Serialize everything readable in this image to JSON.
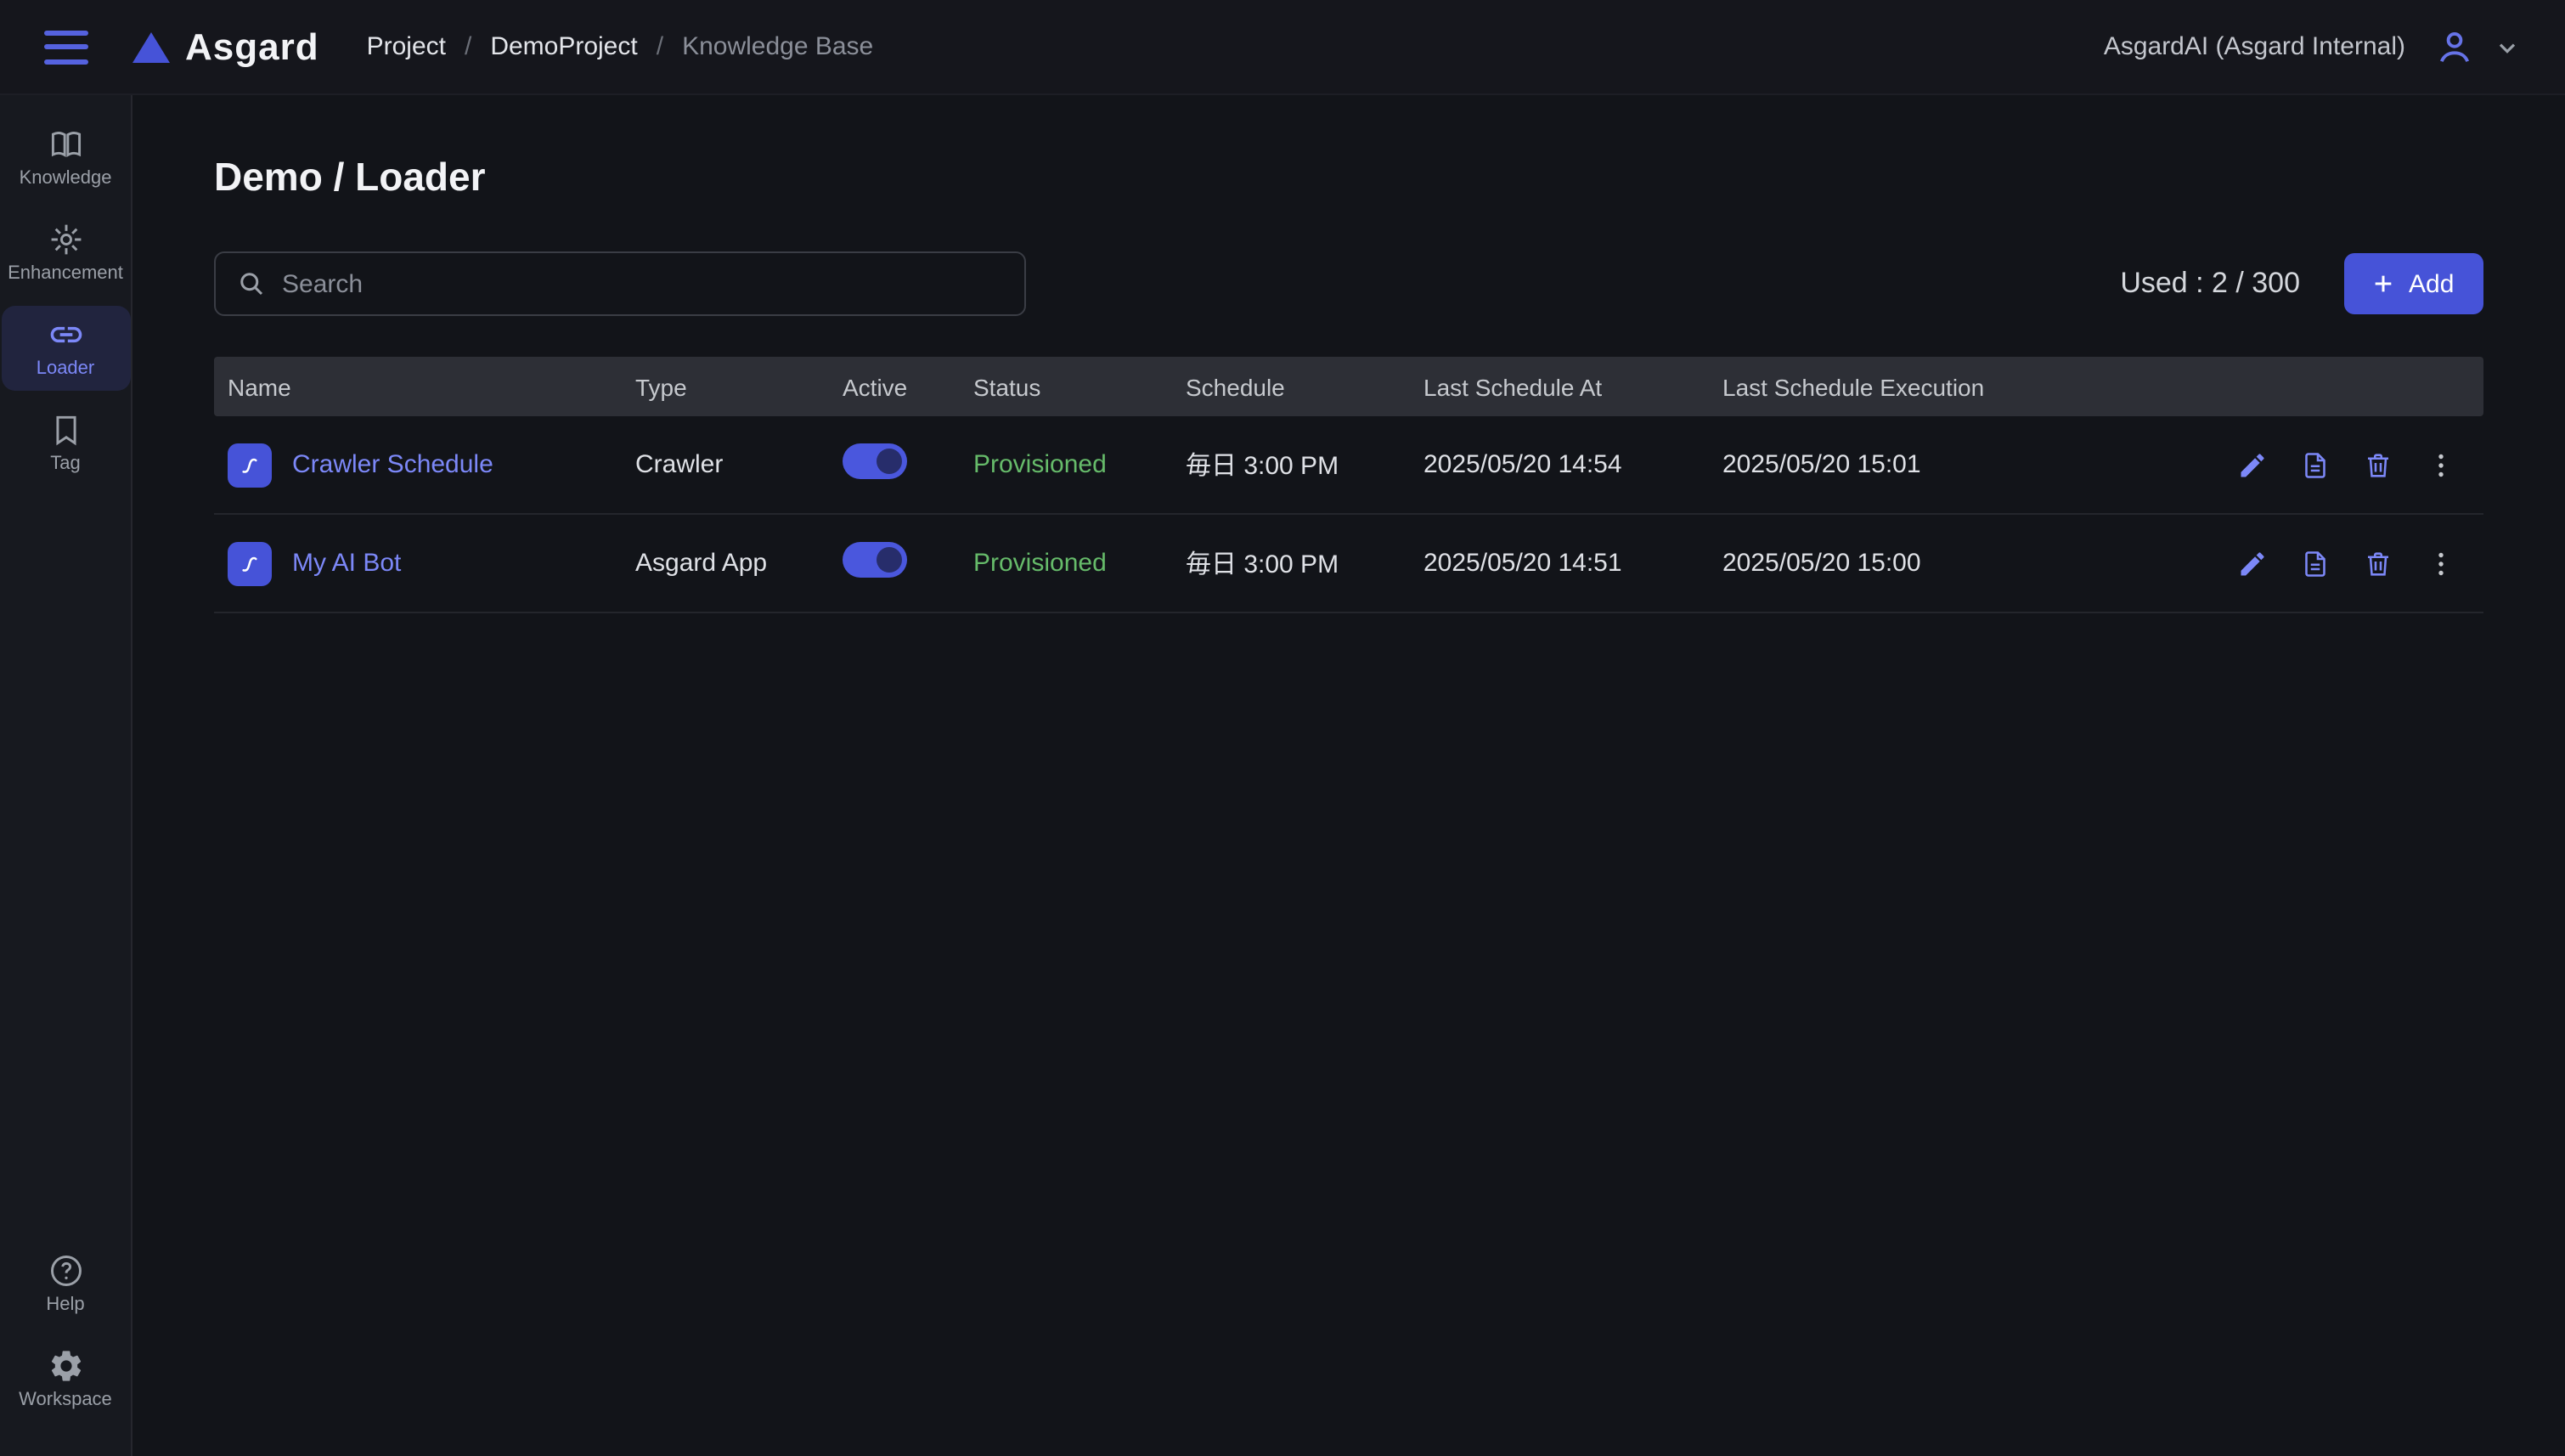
{
  "topbar": {
    "logo_text": "Asgard",
    "breadcrumb": {
      "items": [
        "Project",
        "DemoProject",
        "Knowledge Base"
      ],
      "separator": "/"
    },
    "account_label": "AsgardAI (Asgard Internal)"
  },
  "sidebar": {
    "items": [
      {
        "label": "Knowledge",
        "icon": "book-icon",
        "active": false
      },
      {
        "label": "Enhancement",
        "icon": "flare-icon",
        "active": false
      },
      {
        "label": "Loader",
        "icon": "link-icon",
        "active": true
      },
      {
        "label": "Tag",
        "icon": "bookmark-icon",
        "active": false
      }
    ],
    "bottom_items": [
      {
        "label": "Help",
        "icon": "help-icon"
      },
      {
        "label": "Workspace",
        "icon": "gear-icon"
      }
    ]
  },
  "main": {
    "title": "Demo / Loader",
    "search": {
      "placeholder": "Search"
    },
    "usage_label": "Used : 2 / 300",
    "add_button_label": "Add",
    "table": {
      "columns": [
        "Name",
        "Type",
        "Active",
        "Status",
        "Schedule",
        "Last Schedule At",
        "Last Schedule Execution"
      ],
      "rows": [
        {
          "name": "Crawler Schedule",
          "type": "Crawler",
          "active": true,
          "status": "Provisioned",
          "schedule": "毎日 3:00 PM",
          "last_schedule_at": "2025/05/20 14:54",
          "last_schedule_execution": "2025/05/20 15:01"
        },
        {
          "name": "My AI Bot",
          "type": "Asgard App",
          "active": true,
          "status": "Provisioned",
          "schedule": "毎日 3:00 PM",
          "last_schedule_at": "2025/05/20 14:51",
          "last_schedule_execution": "2025/05/20 15:00"
        }
      ]
    }
  },
  "colors": {
    "accent": "#4653d8",
    "link": "#7c88f8",
    "status_provisioned": "#66bb6a",
    "toggle_track": "#4a57dd"
  }
}
